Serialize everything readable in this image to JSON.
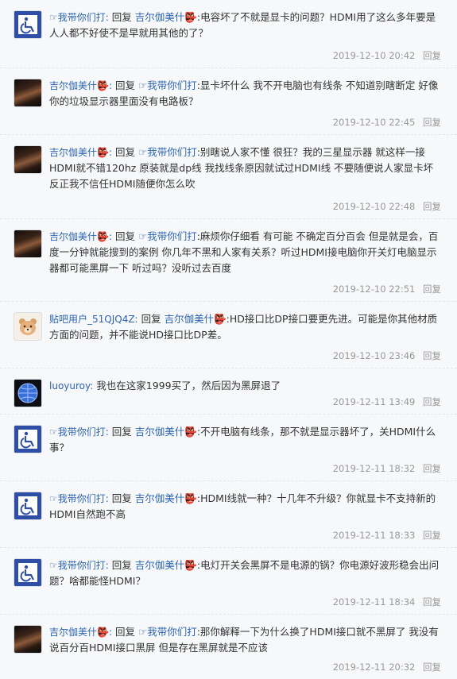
{
  "comments": [
    {
      "user": "☞我带你们打:",
      "reply_word": "回复",
      "target": "吉尔伽美什👺",
      "text": ":电容坏了不就是显卡的问题？HDMI用了这么多年要是人人都不好使不是早就用其他的了？",
      "time": "2019-12-10 20:42",
      "reply": "回复",
      "avatar": "wheelchair-avatar"
    },
    {
      "user": "吉尔伽美什👺:",
      "reply_word": "回复",
      "target": "☞我带你们打",
      "text": ":显卡坏什么 我不开电脑也有线条 不知道别瞎断定 好像你的垃圾显示器里面没有电路板？",
      "time": "2019-12-10 22:45",
      "reply": "回复",
      "avatar": "dark-portrait-avatar"
    },
    {
      "user": "吉尔伽美什👺:",
      "reply_word": "回复",
      "target": "☞我带你们打",
      "text": ":别瞎说人家不懂 很狂？我的三星显示器 就这样一接HDMI就不错120hz 原装就是dp线 我找线条原因就试过HDMI线 不要随便说人家显卡坏 反正我不信任HDMI随便你怎么吹",
      "time": "2019-12-10 22:48",
      "reply": "回复",
      "avatar": "dark-portrait-avatar"
    },
    {
      "user": "吉尔伽美什👺:",
      "reply_word": "回复",
      "target": "☞我带你们打",
      "text": ":麻烦你仔细看 有可能 不确定百分百会 但是就是会，百度一分钟就能搜到的案例 你几年不黑和人家有关系？听过HDMI接电脑你开关灯电脑显示器都可能黑屏一下 听过吗？没听过去百度",
      "time": "2019-12-10 22:51",
      "reply": "回复",
      "avatar": "dark-portrait-avatar"
    },
    {
      "user": "贴吧用户_51QJQ4Z:",
      "reply_word": "回复",
      "target": "吉尔伽美什👺",
      "text": ":HD接口比DP接口要更先进。可能是你其他材质方面的问题，并不能说HD接口比DP差。",
      "time": "2019-12-10 23:46",
      "reply": "回复",
      "avatar": "bear-avatar"
    },
    {
      "user": "luoyuroy:",
      "reply_word": "",
      "target": "",
      "text": "我也在这家1999买了，然后因为黑屏退了",
      "time": "2019-12-11 13:49",
      "reply": "回复",
      "avatar": "globe-avatar"
    },
    {
      "user": "☞我带你们打:",
      "reply_word": "回复",
      "target": "吉尔伽美什👺",
      "text": ":不开电脑有线条，那不就是显示器坏了，关HDMI什么事？",
      "time": "2019-12-11 18:32",
      "reply": "回复",
      "avatar": "wheelchair-avatar"
    },
    {
      "user": "☞我带你们打:",
      "reply_word": "回复",
      "target": "吉尔伽美什👺",
      "text": ":HDMI线就一种？十几年不升级？你就显卡不支持新的HDMI自然跑不高",
      "time": "2019-12-11 18:33",
      "reply": "回复",
      "avatar": "wheelchair-avatar"
    },
    {
      "user": "☞我带你们打:",
      "reply_word": "回复",
      "target": "吉尔伽美什👺",
      "text": ":电灯开关会黑屏不是电源的锅？你电源好波形稳会出问题？啥都能怪HDMI？",
      "time": "2019-12-11 18:34",
      "reply": "回复",
      "avatar": "wheelchair-avatar"
    },
    {
      "user": "吉尔伽美什👺:",
      "reply_word": "回复",
      "target": "☞我带你们打",
      "text": ":那你解释一下为什么换了HDMI接口就不黑屏了 我没有说百分百HDMI接口黑屏 但是存在黑屏就是不应该",
      "time": "2019-12-11 20:32",
      "reply": "回复",
      "avatar": "dark-portrait-avatar"
    }
  ]
}
